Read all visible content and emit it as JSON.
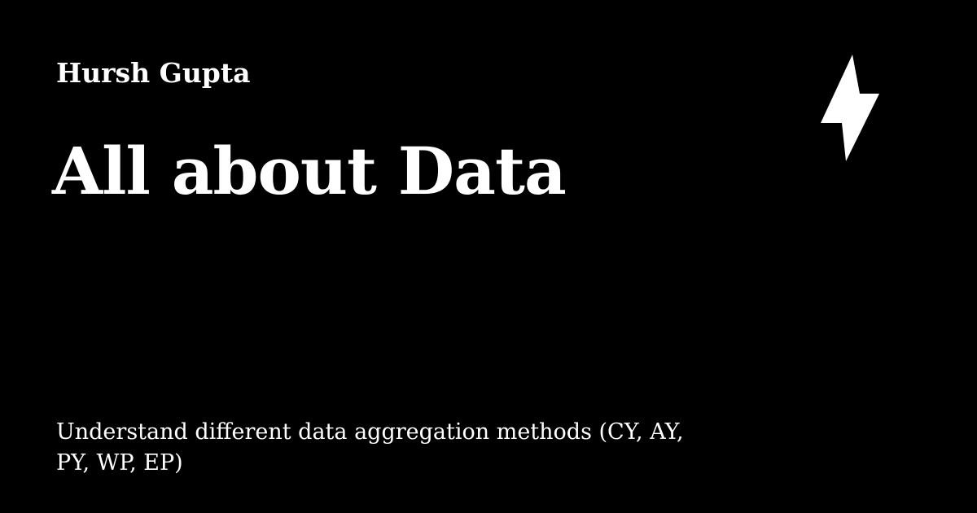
{
  "card": {
    "author": "Hursh Gupta",
    "title": "All about Data",
    "description": "Understand different data aggregation methods (CY, AY, PY, WP, EP)",
    "icon": "lightning-bolt-icon",
    "colors": {
      "background": "#000000",
      "text": "#ffffff",
      "icon": "#ffffff"
    }
  }
}
